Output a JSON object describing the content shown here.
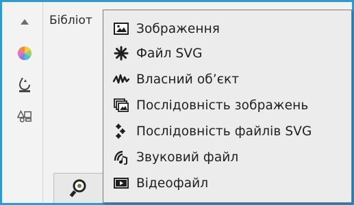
{
  "window": {
    "library_label": "Бібліот"
  },
  "left_rail": {
    "icons": [
      "arrow-up-icon",
      "color-wheel-icon",
      "brush-drop-icon",
      "shapes-icon"
    ]
  },
  "bottom_tab": {
    "icon": "search-lens-icon"
  },
  "menu": {
    "items": [
      {
        "label": "Зображення",
        "icon": "image-icon"
      },
      {
        "label": "Файл SVG",
        "icon": "svg-star-icon"
      },
      {
        "label": "Власний об’єкт",
        "icon": "custom-object-icon"
      },
      {
        "label": "Послідовність зображень",
        "icon": "image-sequence-icon"
      },
      {
        "label": "Послідовність файлів SVG",
        "icon": "svg-sequence-icon"
      },
      {
        "label": "Звуковий файл",
        "icon": "sound-file-icon"
      },
      {
        "label": "Відеофайл",
        "icon": "video-file-icon"
      }
    ]
  },
  "colors": {
    "frame_border": "#2e9ad0",
    "menu_bg": "#ececec",
    "text": "#1e1e1e"
  }
}
